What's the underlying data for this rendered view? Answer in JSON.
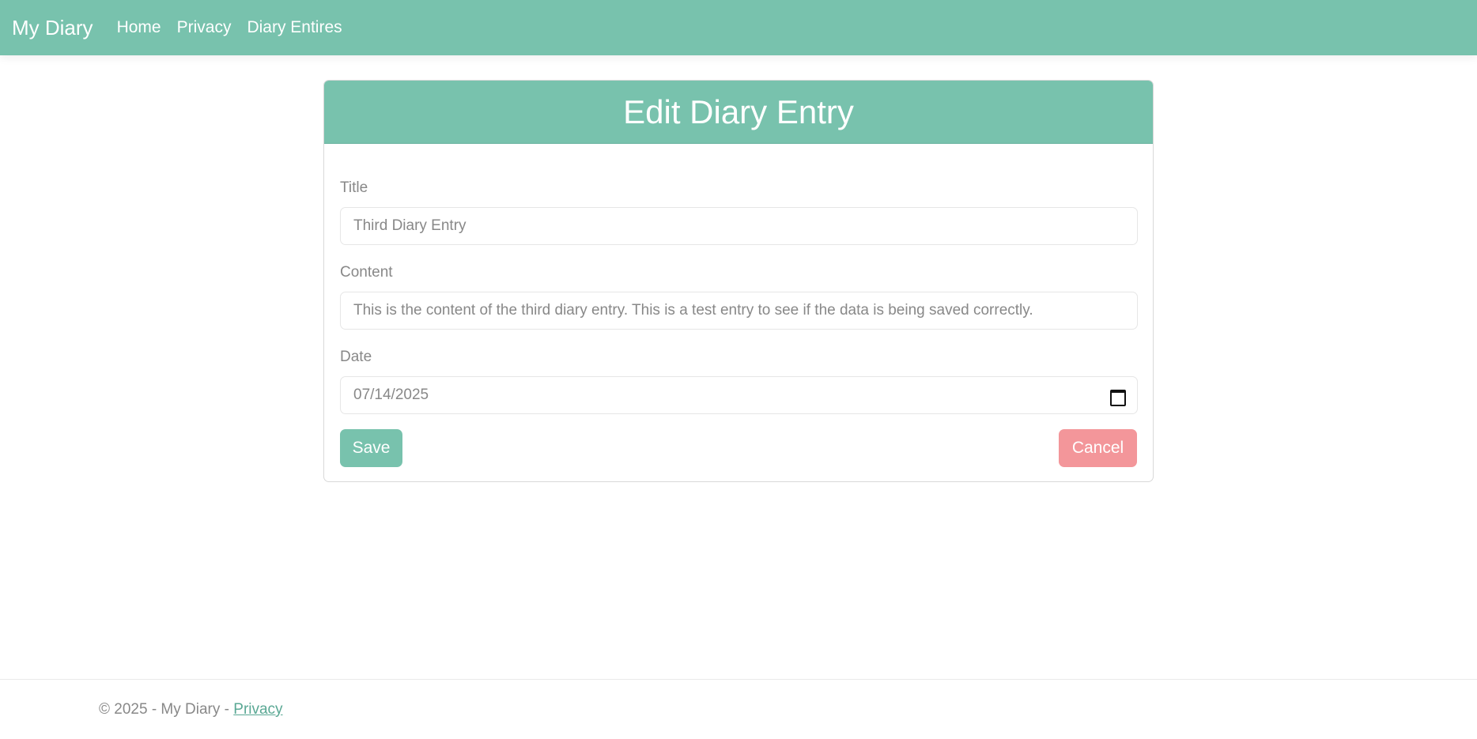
{
  "navbar": {
    "brand": "My Diary",
    "links": [
      {
        "label": "Home"
      },
      {
        "label": "Privacy"
      },
      {
        "label": "Diary Entires"
      }
    ]
  },
  "form": {
    "header": "Edit Diary Entry",
    "fields": {
      "title": {
        "label": "Title",
        "value": "Third Diary Entry"
      },
      "content": {
        "label": "Content",
        "value": "This is the content of the third diary entry. This is a test entry to see if the data is being saved correctly."
      },
      "date": {
        "label": "Date",
        "value": "07/14/2025",
        "icon": "calendar-icon"
      }
    },
    "buttons": {
      "save": "Save",
      "cancel": "Cancel"
    }
  },
  "footer": {
    "text": "© 2025 - My Diary - ",
    "link": "Privacy"
  },
  "colors": {
    "primary": "#78c2ad",
    "danger": "#f3969a",
    "text": "#888888"
  }
}
